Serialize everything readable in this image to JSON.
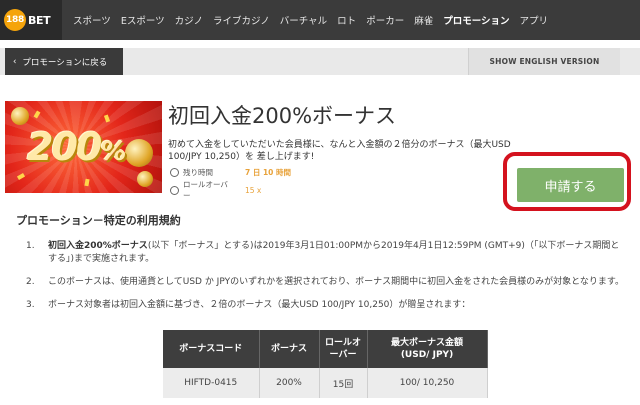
{
  "nav": {
    "logo_number": "188",
    "logo_text": "BET",
    "items": [
      "スポーツ",
      "Eスポーツ",
      "カジノ",
      "ライブカジノ",
      "バーチャル",
      "ロト",
      "ポーカー",
      "麻雀",
      "プロモーション",
      "アプリ"
    ],
    "active_index": 8
  },
  "backbar": {
    "back_label": "プロモーションに戻る",
    "english_label": "SHOW ENGLISH VERSION"
  },
  "banner": {
    "big_text": "200",
    "pct": "%"
  },
  "promo": {
    "title": "初回入金200%ボーナス",
    "description": "初めて入金をしていただいた会員様に、なんと入金額の２倍分のボーナス（最大USD 100/JPY 10,250）を 差し上げます!",
    "remaining_label": "残り時間",
    "remaining_value": "7 日 10 時間",
    "rollover_label": "ロールオーバー",
    "rollover_value": "15 x",
    "apply_label": "申請する"
  },
  "terms": {
    "heading": "プロモーション－特定の利用規約",
    "items": [
      {
        "num": "1.",
        "bold": "初回入金200%ボーナス",
        "text": "(以下「ボーナス」とする)は2019年3月1日01:00PMから2019年4月1日12:59PM (GMT+9)（「以下ボーナス期間とする」)まで実施されます。"
      },
      {
        "num": "2.",
        "bold": "",
        "text": "このボーナスは、使用通貨としてUSD か JPYのいずれかを選択されており、ボーナス期間中に初回入金をされた会員様のみが対象となります。"
      },
      {
        "num": "3.",
        "bold": "",
        "text": "ボーナス対象者は初回入金額に基づき、２倍のボーナス（最大USD 100/JPY 10,250）が贈呈されます："
      }
    ]
  },
  "table": {
    "headers": [
      "ボーナスコード",
      "ボーナス",
      "ロールオーバー",
      "最大ボーナス金額\n(USD/ JPY)"
    ],
    "rows": [
      [
        "HIFTD-0415",
        "200%",
        "15回",
        "100/ 10,250"
      ]
    ]
  },
  "colors": {
    "nav_bg": "#3b3b3b",
    "logo_orange": "#f5a40b",
    "apply_green": "#7fb16a",
    "highlight_red": "#d4121e",
    "meta_orange": "#e8a23a"
  }
}
